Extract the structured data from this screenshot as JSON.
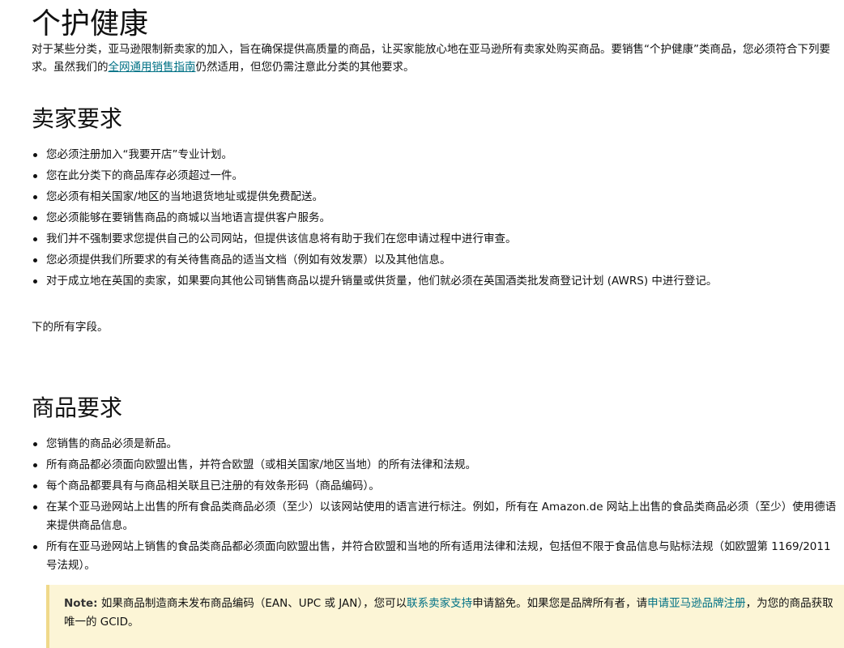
{
  "title": "个护健康",
  "intro": {
    "text_before_link": "对于某些分类，亚马逊限制新卖家的加入，旨在确保提供高质量的商品，让买家能放心地在亚马逊所有卖家处购买商品。要销售“个护健康”类商品，您必须符合下列要求。虽然我们的",
    "link": "全网通用销售指南",
    "text_after_link": "仍然适用，但您仍需注意此分类的其他要求。"
  },
  "seller_section": {
    "heading": "卖家要求",
    "items": [
      "您必须注册加入“我要开店”专业计划。",
      "您在此分类下的商品库存必须超过一件。",
      "您必须有相关国家/地区的当地退货地址或提供免费配送。",
      "您必须能够在要销售商品的商城以当地语言提供客户服务。",
      "我们并不强制要求您提供自己的公司网站，但提供该信息将有助于我们在您申请过程中进行审查。",
      "您必须提供我们所要求的有关待售商品的适当文档（例如有效发票）以及其他信息。",
      "对于成立地在英国的卖家，如果要向其他公司销售商品以提升销量或供货量，他们就必须在英国酒类批发商登记计划 (AWRS) 中进行登记。"
    ]
  },
  "fields_text": "下的所有字段。",
  "product_section": {
    "heading": "商品要求",
    "items": [
      "您销售的商品必须是新品。",
      "所有商品都必须面向欧盟出售，并符合欧盟（或相关国家/地区当地）的所有法律和法规。",
      "每个商品都要具有与商品相关联且已注册的有效条形码（商品编码）。",
      "在某个亚马逊网站上出售的所有食品类商品必须（至少）以该网站使用的语言进行标注。例如，所有在 Amazon.de 网站上出售的食品类商品必须（至少）使用德语来提供商品信息。",
      "所有在亚马逊网站上销售的食品类商品都必须面向欧盟出售，并符合欧盟和当地的所有适用法律和法规，包括但不限于食品信息与贴标法规（如欧盟第 1169/2011 号法规）。"
    ]
  },
  "note": {
    "label": "Note:",
    "text1": " 如果商品制造商未发布商品编码（EAN、UPC 或 JAN），您可以",
    "link1": "联系卖家支持",
    "text2": "申请豁免。如果您是品牌所有者，请",
    "link2": "申请亚马逊品牌注册",
    "text3": "，为您的商品获取唯一的 GCID。"
  },
  "colors": {
    "link": "#007185",
    "note_background": "#fcf5d6"
  }
}
